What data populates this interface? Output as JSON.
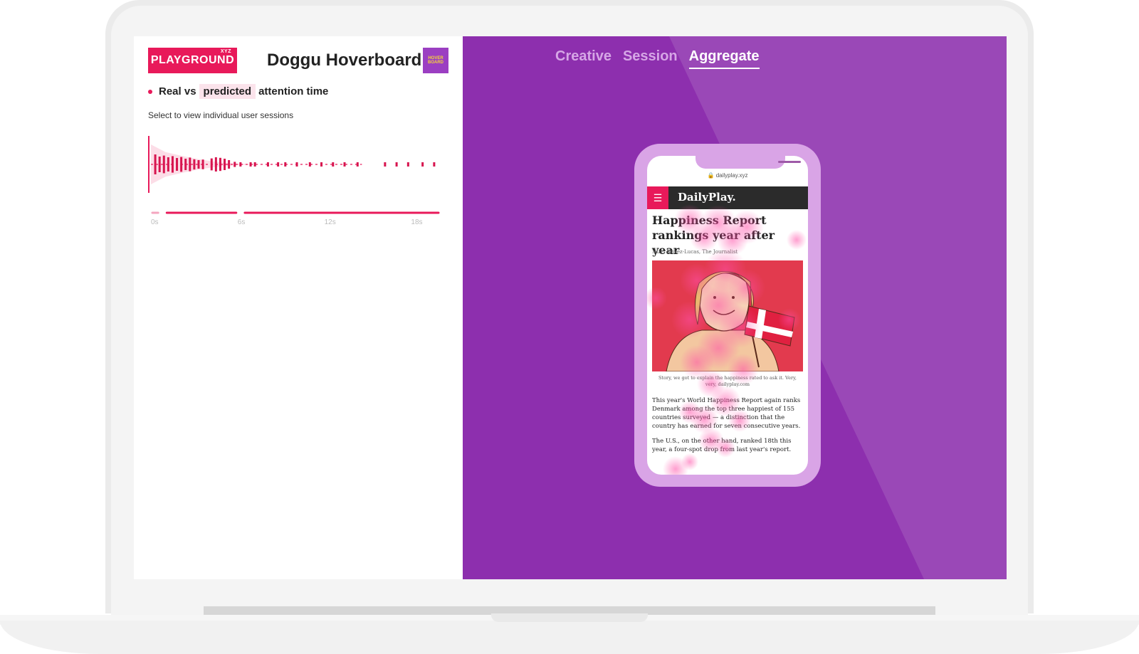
{
  "app": {
    "brand": "PLAYGROUND",
    "brand_suffix": "XYZ",
    "title": "Doggu Hoverboard",
    "thumbnail_text": "HOVER BOARD"
  },
  "legend": {
    "text_real_vs": "Real vs",
    "text_predicted": "predicted",
    "text_attention": "attention time"
  },
  "hint": "Select to view individual user sessions",
  "tabs": [
    {
      "label": "Creative",
      "active": false
    },
    {
      "label": "Session",
      "active": false
    },
    {
      "label": "Aggregate",
      "active": true
    }
  ],
  "phone_page": {
    "url": "dailyplay.xyz",
    "site_name": "DailyPlay.",
    "headline": "Happiness Report rankings year after year",
    "byline": "Nizzi Brivez-Lucas, The Journalist",
    "caption": "Story, we got to explain the happiness rated to ask it. Very, very, dailyplay.com",
    "paragraph_1": "This year's World Happiness Report again ranks Denmark among the top three happiest of 155 countries surveyed — a distinction that the country has earned for seven consecutive years.",
    "paragraph_2": "The U.S., on the other hand, ranked 18th this year, a four-spot drop from last year's report."
  },
  "colors": {
    "accent": "#e8195a",
    "panel_purple": "#8d2fae",
    "tab_inactive": "#d6a6e6",
    "tab_active": "#ffffff"
  },
  "chart_data": {
    "type": "area",
    "title": "",
    "x_ticks": [
      "0s",
      "6s",
      "12s",
      "18s"
    ],
    "xlim": [
      0,
      20
    ],
    "predicted_envelope": [
      {
        "x": 0,
        "y": 1.0
      },
      {
        "x": 1,
        "y": 0.62
      },
      {
        "x": 2,
        "y": 0.45
      },
      {
        "x": 3,
        "y": 0.3
      },
      {
        "x": 4,
        "y": 0.18
      },
      {
        "x": 5,
        "y": 0.09
      },
      {
        "x": 6,
        "y": 0.04
      },
      {
        "x": 7,
        "y": 0.02
      },
      {
        "x": 8,
        "y": 0.0
      }
    ],
    "real_events": [
      {
        "x": 0.3,
        "y": 0.7
      },
      {
        "x": 0.6,
        "y": 0.55
      },
      {
        "x": 0.9,
        "y": 0.62
      },
      {
        "x": 1.2,
        "y": 0.5
      },
      {
        "x": 1.5,
        "y": 0.58
      },
      {
        "x": 1.8,
        "y": 0.45
      },
      {
        "x": 2.1,
        "y": 0.52
      },
      {
        "x": 2.4,
        "y": 0.4
      },
      {
        "x": 2.7,
        "y": 0.48
      },
      {
        "x": 3.0,
        "y": 0.36
      },
      {
        "x": 3.3,
        "y": 0.3
      },
      {
        "x": 3.6,
        "y": 0.34
      },
      {
        "x": 4.2,
        "y": 0.42
      },
      {
        "x": 4.5,
        "y": 0.5
      },
      {
        "x": 4.8,
        "y": 0.46
      },
      {
        "x": 5.1,
        "y": 0.4
      },
      {
        "x": 5.4,
        "y": 0.3
      },
      {
        "x": 5.8,
        "y": 0.18
      },
      {
        "x": 6.2,
        "y": 0.12
      },
      {
        "x": 6.9,
        "y": 0.15
      },
      {
        "x": 7.2,
        "y": 0.12
      },
      {
        "x": 8.1,
        "y": 0.08
      },
      {
        "x": 8.8,
        "y": 0.12
      },
      {
        "x": 9.3,
        "y": 0.1
      },
      {
        "x": 10.1,
        "y": 0.1
      },
      {
        "x": 11.0,
        "y": 0.08
      },
      {
        "x": 11.8,
        "y": 0.08
      },
      {
        "x": 12.6,
        "y": 0.1
      },
      {
        "x": 13.4,
        "y": 0.14
      },
      {
        "x": 14.3,
        "y": 0.12
      },
      {
        "x": 16.2,
        "y": 0.05
      },
      {
        "x": 17.0,
        "y": 0.05
      },
      {
        "x": 17.8,
        "y": 0.05
      },
      {
        "x": 18.8,
        "y": 0.05
      },
      {
        "x": 19.6,
        "y": 0.05
      }
    ],
    "session_segments": [
      [
        0,
        0.6
      ],
      [
        1,
        6
      ],
      [
        6.4,
        20
      ]
    ]
  }
}
